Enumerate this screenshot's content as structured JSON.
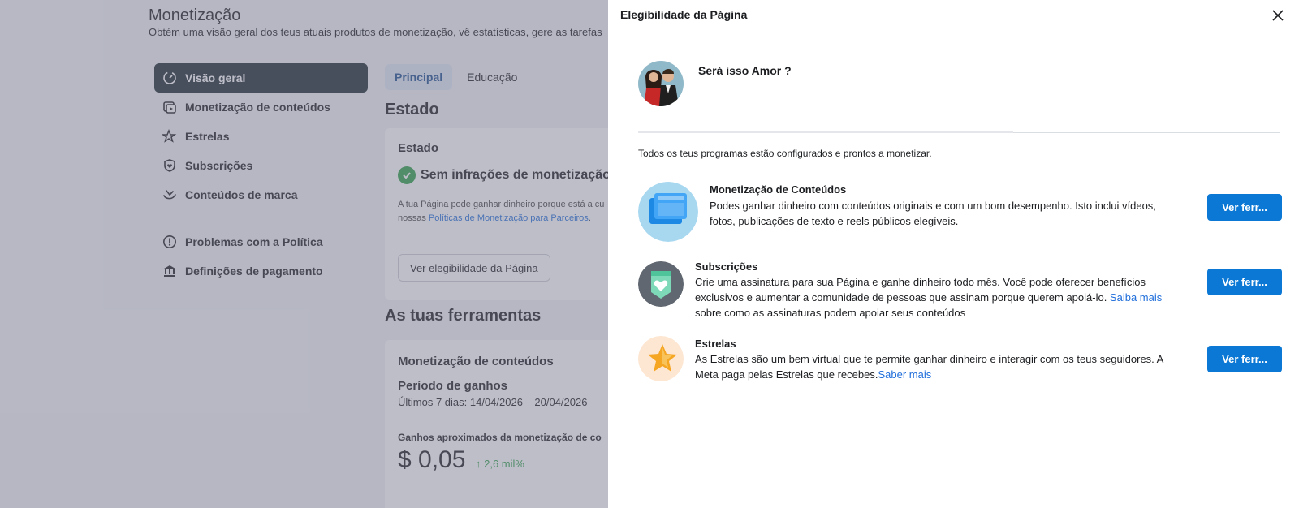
{
  "background": {
    "title": "Monetização",
    "subtitle": "Obtém uma visão geral dos teus atuais produtos de monetização, vê estatísticas, gere as tarefas",
    "nav": [
      {
        "label": "Visão geral",
        "icon": "dashboard-icon"
      },
      {
        "label": "Monetização de conteúdos",
        "icon": "video-play-icon"
      },
      {
        "label": "Estrelas",
        "icon": "stars-icon"
      },
      {
        "label": "Subscrições",
        "icon": "shield-heart-icon"
      },
      {
        "label": "Conteúdos de marca",
        "icon": "handshake-icon"
      },
      {
        "label": "Problemas com a Política",
        "icon": "alert-circle-icon"
      },
      {
        "label": "Definições de pagamento",
        "icon": "bank-icon"
      }
    ],
    "tabs": [
      "Principal",
      "Educação"
    ],
    "estado_heading": "Estado",
    "status_card": {
      "title": "Estado",
      "status": "Sem infrações de monetização",
      "desc_line1": "A tua Página pode ganhar dinheiro porque está a cu",
      "desc_line2_prefix": "nossas ",
      "desc_link": "Políticas de Monetização para Parceiros",
      "desc_suffix": ".",
      "button": "Ver elegibilidade da Página"
    },
    "tools_heading": "As tuas ferramentas",
    "tools_card": {
      "title": "Monetização de conteúdos",
      "period_title": "Período de ganhos",
      "period_dates": "Últimos 7 dias: 14/04/2026 – 20/04/2026",
      "earnings_label": "Ganhos aproximados da monetização de co",
      "earnings_value": "$ 0,05",
      "earnings_change": "2,6 mil%"
    }
  },
  "dialog": {
    "title": "Elegibilidade da Página",
    "page_name": "Será isso Amor ?",
    "intro": "Todos os teus programas estão configurados e prontos a monetizar.",
    "programs": [
      {
        "title": "Monetização de Conteúdos",
        "desc": "Podes ganhar dinheiro com conteúdos originais e com um bom desempenho. Isto inclui vídeos, fotos, publicações de texto e reels públicos elegíveis.",
        "button": "Ver ferr..."
      },
      {
        "title": "Subscrições",
        "desc": "Crie uma assinatura para sua Página e ganhe dinheiro todo mês. Você pode oferecer benefícios exclusivos e aumentar a comunidade de pessoas que assinam porque querem apoiá-lo. ",
        "link": "Saiba mais",
        "desc_after": " sobre como as assinaturas podem apoiar seus conteúdos",
        "button": "Ver ferr..."
      },
      {
        "title": "Estrelas",
        "desc": "As Estrelas são um bem virtual que te permite ganhar dinheiro e interagir com os teus seguidores. A Meta paga pelas Estrelas que recebes.",
        "link": "Saber mais",
        "button": "Ver ferr..."
      }
    ]
  },
  "colors": {
    "primary_button": "#0a78d4",
    "nav_active": "#1c2b33",
    "success": "#31a24c",
    "link": "#216fdb"
  }
}
